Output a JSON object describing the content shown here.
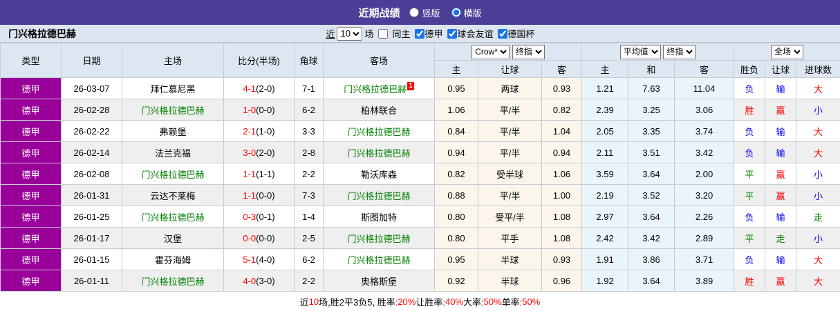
{
  "topbar": {
    "title": "近期战绩",
    "radios": [
      {
        "label": "竖版",
        "checked": false
      },
      {
        "label": "横版",
        "checked": true
      }
    ]
  },
  "filter": {
    "team_title": "门兴格拉德巴赫",
    "near_label": "近",
    "count_select": "10",
    "games_label": "场",
    "checkboxes": [
      {
        "label": "同主",
        "checked": false
      },
      {
        "label": "德甲",
        "checked": true
      },
      {
        "label": "球会友谊",
        "checked": true
      },
      {
        "label": "德国杯",
        "checked": true
      }
    ]
  },
  "table": {
    "left_headers": [
      "类型",
      "日期",
      "主场",
      "比分(半场)",
      "角球",
      "客场"
    ],
    "selects": {
      "handicap_source": "Crow*",
      "handicap_stage": "终指",
      "europe_source": "平均值",
      "europe_stage": "终指",
      "result_scope": "全场"
    },
    "sub_headers": {
      "handicap": [
        "主",
        "让球",
        "客"
      ],
      "europe": [
        "主",
        "和",
        "客"
      ],
      "result": [
        "胜负",
        "让球",
        "进球数"
      ]
    },
    "rows": [
      {
        "league": "德甲",
        "date": "26-03-07",
        "home": {
          "name": "拜仁慕尼黑",
          "self": false
        },
        "score": {
          "ft": "4-1",
          "ht": "(2-0)"
        },
        "corner": "7-1",
        "away": {
          "name": "门兴格拉德巴赫",
          "self": true,
          "badge": "1"
        },
        "handicap": [
          "0.95",
          "两球",
          "0.93"
        ],
        "europe": [
          "1.21",
          "7.63",
          "11.04"
        ],
        "results": [
          {
            "text": "负",
            "color": "blue"
          },
          {
            "text": "输",
            "color": "blue"
          },
          {
            "text": "大",
            "color": "red"
          }
        ]
      },
      {
        "league": "德甲",
        "date": "26-02-28",
        "home": {
          "name": "门兴格拉德巴赫",
          "self": true
        },
        "score": {
          "ft": "1-0",
          "ht": "(0-0)"
        },
        "corner": "6-2",
        "away": {
          "name": "柏林联合",
          "self": false
        },
        "handicap": [
          "1.06",
          "平/半",
          "0.82"
        ],
        "europe": [
          "2.39",
          "3.25",
          "3.06"
        ],
        "results": [
          {
            "text": "胜",
            "color": "red"
          },
          {
            "text": "赢",
            "color": "red"
          },
          {
            "text": "小",
            "color": "blue"
          }
        ]
      },
      {
        "league": "德甲",
        "date": "26-02-22",
        "home": {
          "name": "弗赖堡",
          "self": false
        },
        "score": {
          "ft": "2-1",
          "ht": "(1-0)"
        },
        "corner": "3-3",
        "away": {
          "name": "门兴格拉德巴赫",
          "self": true
        },
        "handicap": [
          "0.84",
          "平/半",
          "1.04"
        ],
        "europe": [
          "2.05",
          "3.35",
          "3.74"
        ],
        "results": [
          {
            "text": "负",
            "color": "blue"
          },
          {
            "text": "输",
            "color": "blue"
          },
          {
            "text": "大",
            "color": "red"
          }
        ]
      },
      {
        "league": "德甲",
        "date": "26-02-14",
        "home": {
          "name": "法兰克福",
          "self": false
        },
        "score": {
          "ft": "3-0",
          "ht": "(2-0)"
        },
        "corner": "2-8",
        "away": {
          "name": "门兴格拉德巴赫",
          "self": true
        },
        "handicap": [
          "0.94",
          "平/半",
          "0.94"
        ],
        "europe": [
          "2.11",
          "3.51",
          "3.42"
        ],
        "results": [
          {
            "text": "负",
            "color": "blue"
          },
          {
            "text": "输",
            "color": "blue"
          },
          {
            "text": "大",
            "color": "red"
          }
        ]
      },
      {
        "league": "德甲",
        "date": "26-02-08",
        "home": {
          "name": "门兴格拉德巴赫",
          "self": true
        },
        "score": {
          "ft": "1-1",
          "ht": "(1-1)"
        },
        "corner": "2-2",
        "away": {
          "name": "勒沃库森",
          "self": false
        },
        "handicap": [
          "0.82",
          "受半球",
          "1.06"
        ],
        "europe": [
          "3.59",
          "3.64",
          "2.00"
        ],
        "results": [
          {
            "text": "平",
            "color": "green"
          },
          {
            "text": "赢",
            "color": "red"
          },
          {
            "text": "小",
            "color": "blue"
          }
        ]
      },
      {
        "league": "德甲",
        "date": "26-01-31",
        "home": {
          "name": "云达不莱梅",
          "self": false
        },
        "score": {
          "ft": "1-1",
          "ht": "(0-0)"
        },
        "corner": "7-3",
        "away": {
          "name": "门兴格拉德巴赫",
          "self": true
        },
        "handicap": [
          "0.88",
          "平/半",
          "1.00"
        ],
        "europe": [
          "2.19",
          "3.52",
          "3.20"
        ],
        "results": [
          {
            "text": "平",
            "color": "green"
          },
          {
            "text": "赢",
            "color": "red"
          },
          {
            "text": "小",
            "color": "blue"
          }
        ]
      },
      {
        "league": "德甲",
        "date": "26-01-25",
        "home": {
          "name": "门兴格拉德巴赫",
          "self": true
        },
        "score": {
          "ft": "0-3",
          "ht": "(0-1)"
        },
        "corner": "1-4",
        "away": {
          "name": "斯图加特",
          "self": false
        },
        "handicap": [
          "0.80",
          "受平/半",
          "1.08"
        ],
        "europe": [
          "2.97",
          "3.64",
          "2.26"
        ],
        "results": [
          {
            "text": "负",
            "color": "blue"
          },
          {
            "text": "输",
            "color": "blue"
          },
          {
            "text": "走",
            "color": "green"
          }
        ]
      },
      {
        "league": "德甲",
        "date": "26-01-17",
        "home": {
          "name": "汉堡",
          "self": false
        },
        "score": {
          "ft": "0-0",
          "ht": "(0-0)"
        },
        "corner": "2-5",
        "away": {
          "name": "门兴格拉德巴赫",
          "self": true
        },
        "handicap": [
          "0.80",
          "平手",
          "1.08"
        ],
        "europe": [
          "2.42",
          "3.42",
          "2.89"
        ],
        "results": [
          {
            "text": "平",
            "color": "green"
          },
          {
            "text": "走",
            "color": "green"
          },
          {
            "text": "小",
            "color": "blue"
          }
        ]
      },
      {
        "league": "德甲",
        "date": "26-01-15",
        "home": {
          "name": "霍芬海姆",
          "self": false
        },
        "score": {
          "ft": "5-1",
          "ht": "(4-0)"
        },
        "corner": "6-2",
        "away": {
          "name": "门兴格拉德巴赫",
          "self": true
        },
        "handicap": [
          "0.95",
          "半球",
          "0.93"
        ],
        "europe": [
          "1.91",
          "3.86",
          "3.71"
        ],
        "results": [
          {
            "text": "负",
            "color": "blue"
          },
          {
            "text": "输",
            "color": "blue"
          },
          {
            "text": "大",
            "color": "red"
          }
        ]
      },
      {
        "league": "德甲",
        "date": "26-01-11",
        "home": {
          "name": "门兴格拉德巴赫",
          "self": true
        },
        "score": {
          "ft": "4-0",
          "ht": "(3-0)"
        },
        "corner": "2-2",
        "away": {
          "name": "奥格斯堡",
          "self": false
        },
        "handicap": [
          "0.92",
          "半球",
          "0.96"
        ],
        "europe": [
          "1.92",
          "3.64",
          "3.89"
        ],
        "results": [
          {
            "text": "胜",
            "color": "red"
          },
          {
            "text": "赢",
            "color": "red"
          },
          {
            "text": "大",
            "color": "red"
          }
        ]
      }
    ]
  },
  "footer": {
    "segments": [
      {
        "text": "近",
        "red": false
      },
      {
        "text": "10",
        "red": true
      },
      {
        "text": "场,胜2平3负5, 胜率:",
        "red": false
      },
      {
        "text": "20%",
        "red": true
      },
      {
        "text": " 让胜率:",
        "red": false
      },
      {
        "text": "40%",
        "red": true
      },
      {
        "text": " 大率:",
        "red": false
      },
      {
        "text": "50%",
        "red": true
      },
      {
        "text": " 单率:",
        "red": false
      },
      {
        "text": "50%",
        "red": true
      }
    ]
  },
  "colors": {
    "topbar_bg": "#4a3e96",
    "league_badge_bg": "#990099",
    "self_team_green": "#008000",
    "score_red": "#ff0000",
    "result_red": "#ff0000",
    "result_blue": "#0000ee",
    "result_green": "#008000",
    "handicap_tint": "#fcf5ec",
    "europe_tint": "#eaf4fb"
  }
}
